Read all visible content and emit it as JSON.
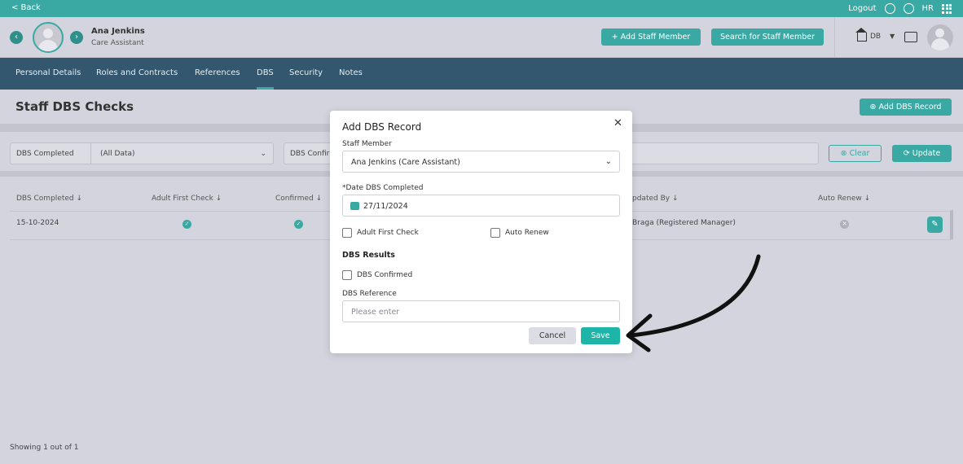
{
  "topbar": {
    "back": "< Back",
    "logout": "Logout",
    "hr": "HR"
  },
  "header": {
    "name": "Ana Jenkins",
    "role": "Care Assistant",
    "add_staff": "Add Staff Member",
    "search_staff": "Search for Staff Member",
    "db": "DB"
  },
  "tabs": [
    "Personal Details",
    "Roles and Contracts",
    "References",
    "DBS",
    "Security",
    "Notes"
  ],
  "page": {
    "title": "Staff DBS Checks",
    "add_record": "Add DBS Record"
  },
  "filters": {
    "dbs_completed_label": "DBS Completed",
    "dbs_completed_value": "(All Data)",
    "dbs_confirmed_label": "DBS Confirm",
    "clear": "Clear",
    "update": "Update"
  },
  "table": {
    "headers": [
      "DBS Completed",
      "Adult First Check",
      "Confirmed",
      "pdated By",
      "Auto Renew"
    ],
    "row": {
      "date": "15-10-2024",
      "updated_by": "Braga (Registered Manager)"
    }
  },
  "footer": {
    "showing": "Showing 1 out of 1"
  },
  "modal": {
    "title": "Add DBS Record",
    "staff_label": "Staff Member",
    "staff_value": "Ana Jenkins (Care Assistant)",
    "date_label": "*Date DBS Completed",
    "date_value": "27/11/2024",
    "adult_first_check": "Adult First Check",
    "auto_renew": "Auto Renew",
    "results_title": "DBS Results",
    "dbs_confirmed": "DBS Confirmed",
    "reference_label": "DBS Reference",
    "reference_placeholder": "Please enter",
    "cancel": "Cancel",
    "save": "Save"
  },
  "colors": {
    "accent": "#3aa9a3",
    "nav": "#33576e",
    "overlay": "#d4d4de"
  }
}
